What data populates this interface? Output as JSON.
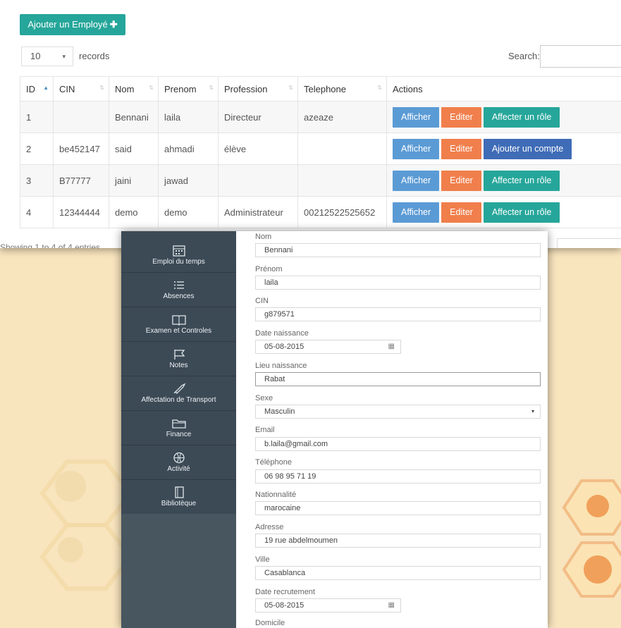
{
  "employees_page": {
    "add_button": "Ajouter un Employé",
    "add_icon": "plus-icon",
    "page_length": "10",
    "records_label": "records",
    "search_label": "Search:",
    "search_value": "",
    "columns": [
      "ID",
      "CIN",
      "Nom",
      "Prenom",
      "Profession",
      "Telephone",
      "Actions"
    ],
    "rows": [
      {
        "id": "1",
        "cin": "",
        "nom": "Bennani",
        "prenom": "laila",
        "profession": "Directeur",
        "telephone": "azeaze",
        "actions": [
          "Afficher",
          "Editer",
          "Affecter un rôle"
        ]
      },
      {
        "id": "2",
        "cin": "be452147",
        "nom": "said",
        "prenom": "ahmadi",
        "profession": "élève",
        "telephone": "",
        "actions": [
          "Afficher",
          "Editer",
          "Ajouter un compte"
        ]
      },
      {
        "id": "3",
        "cin": "B77777",
        "nom": "jaini",
        "prenom": "jawad",
        "profession": "",
        "telephone": "",
        "actions": [
          "Afficher",
          "Editer",
          "Affecter un rôle"
        ]
      },
      {
        "id": "4",
        "cin": "12344444",
        "nom": "demo",
        "prenom": "demo",
        "profession": "Administrateur",
        "telephone": "00212522525652",
        "actions": [
          "Afficher",
          "Editer",
          "Affecter un rôle"
        ]
      }
    ],
    "showing_text": "Showing 1 to 4 of 4 entries"
  },
  "sidebar": {
    "items": [
      {
        "label": "Emploi du temps",
        "icon": "calendar-icon"
      },
      {
        "label": "Absences",
        "icon": "list-icon"
      },
      {
        "label": "Examen et Controles",
        "icon": "book-icon"
      },
      {
        "label": "Notes",
        "icon": "flag-icon"
      },
      {
        "label": "Affectation de Transport",
        "icon": "rocket-icon"
      },
      {
        "label": "Finance",
        "icon": "folder-icon"
      },
      {
        "label": "Activité",
        "icon": "basketball-icon"
      },
      {
        "label": "Bibliotèque",
        "icon": "notebook-icon"
      }
    ]
  },
  "form": {
    "fields": [
      {
        "label": "Nom",
        "value": "Bennani"
      },
      {
        "label": "Prénom",
        "value": "laila"
      },
      {
        "label": "CIN",
        "value": "g879571"
      },
      {
        "label": "Date naissance",
        "value": "05-08-2015"
      },
      {
        "label": "Lieu naissance",
        "value": "Rabat"
      },
      {
        "label": "Sexe",
        "value": "Masculin"
      },
      {
        "label": "Email",
        "value": "b.laila@gmail.com"
      },
      {
        "label": "Téléphone",
        "value": "06 98 95 71 19"
      },
      {
        "label": "Nationnalité",
        "value": "marocaine"
      },
      {
        "label": "Adresse",
        "value": "19 rue abdelmoumen"
      },
      {
        "label": "Ville",
        "value": "Casablanca"
      },
      {
        "label": "Date recrutement",
        "value": "05-08-2015"
      },
      {
        "label": "Domicile",
        "value": ""
      }
    ]
  },
  "colors": {
    "primary_teal": "#26a69a",
    "show_blue": "#5b9bd5",
    "edit_orange": "#f07f4c",
    "account_blue": "#3f6cb7",
    "sidebar": "#3c4a56",
    "background": "#f8e4bd"
  }
}
